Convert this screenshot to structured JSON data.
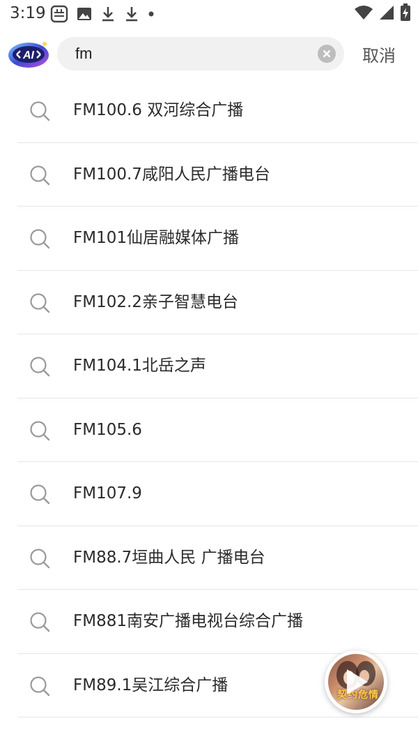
{
  "status_bar": {
    "time": "3:19",
    "icons_left": [
      "keyboard-icon",
      "image-icon",
      "download-icon",
      "download-icon",
      "dot-icon"
    ],
    "icons_right": [
      "wifi-icon",
      "cellular-signal-icon",
      "battery-charging-icon"
    ]
  },
  "header": {
    "logo_text": "AI",
    "search": {
      "value": "fm",
      "placeholder": ""
    },
    "cancel_label": "取消"
  },
  "suggestions": [
    {
      "label": "FM100.6 双河综合广播"
    },
    {
      "label": "FM100.7咸阳人民广播电台"
    },
    {
      "label": "FM101仙居融媒体广播"
    },
    {
      "label": "FM102.2亲子智慧电台"
    },
    {
      "label": "FM104.1北岳之声"
    },
    {
      "label": "FM105.6"
    },
    {
      "label": "FM107.9"
    },
    {
      "label": "FM88.7垣曲人民 广播电台"
    },
    {
      "label": "FM881南安广播电视台综合广播"
    },
    {
      "label": "FM89.1吴江综合广播"
    }
  ],
  "floating_player": {
    "cover_text": "契约危情"
  },
  "colors": {
    "accent_logo": "#3b4bd8",
    "search_bg": "#f1f1f1",
    "divider": "#e6e6e6",
    "text_primary": "#2b2b2b",
    "icon_gray": "#9a9a9a"
  }
}
